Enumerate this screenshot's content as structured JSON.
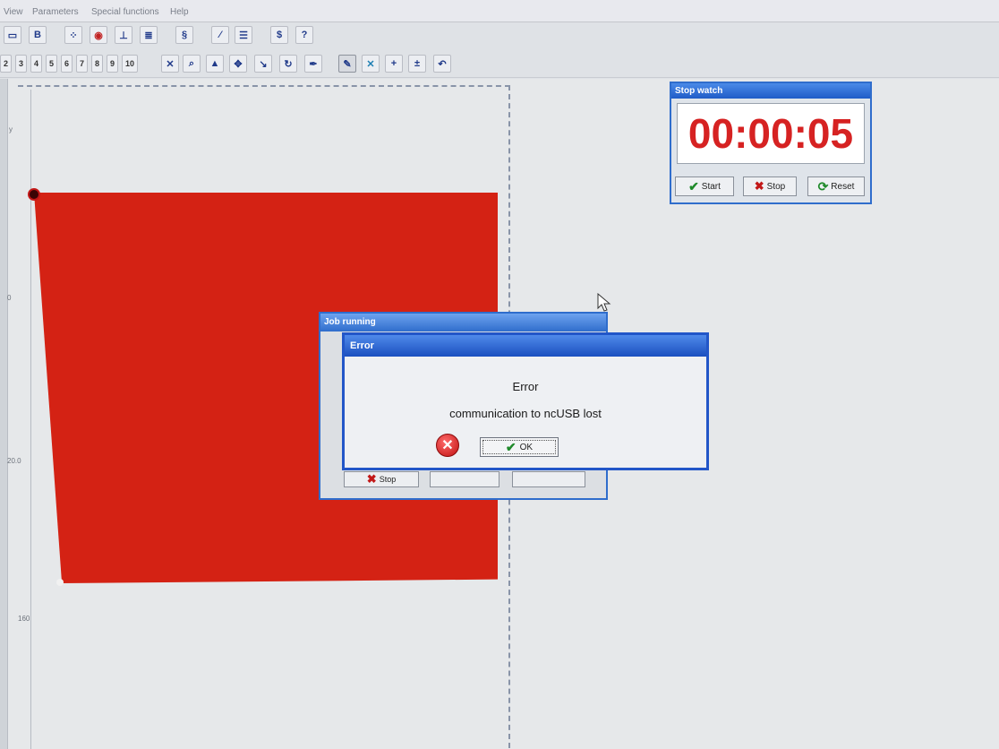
{
  "menu": {
    "items": [
      "View",
      "Parameters",
      "Special functions",
      "Help"
    ]
  },
  "toolbar_numbers": [
    "2",
    "3",
    "4",
    "5",
    "6",
    "7",
    "8",
    "9",
    "10"
  ],
  "help_symbol": "?",
  "ruler": {
    "labels": [
      "y",
      "0",
      "20.0",
      "160"
    ]
  },
  "stopwatch": {
    "title": "Stop watch",
    "time": "00:00:05",
    "start_label": "Start",
    "stop_label": "Stop",
    "reset_label": "Reset"
  },
  "job_dialog": {
    "title": "Job running",
    "stop_label": "Stop"
  },
  "error_dialog": {
    "title": "Error",
    "heading": "Error",
    "message": "communication to ncUSB lost",
    "ok_label": "OK"
  },
  "colors": {
    "shape": "#d42214",
    "timer_digits": "#d62222",
    "title_bar": "#2256c8"
  }
}
